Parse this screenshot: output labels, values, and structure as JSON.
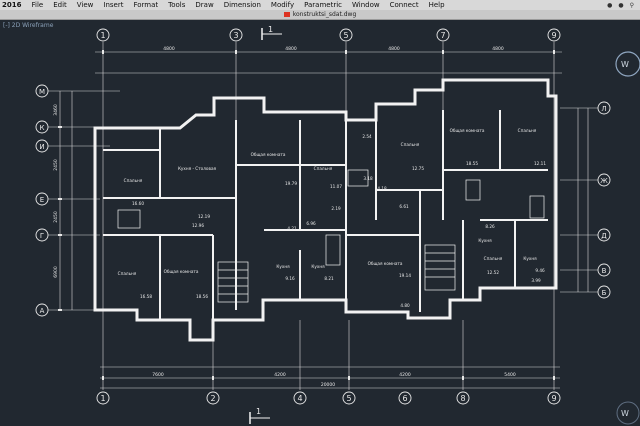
{
  "menubar": {
    "app": "2016",
    "items": [
      "File",
      "Edit",
      "View",
      "Insert",
      "Format",
      "Tools",
      "Draw",
      "Dimension",
      "Modify",
      "Parametric",
      "Window",
      "Connect",
      "Help"
    ]
  },
  "document": {
    "title": "konstruktsi_sdat.dwg"
  },
  "viewport": {
    "label": "[-] 2D Wireframe"
  },
  "viewcube": {
    "label": "W"
  },
  "section_mark": {
    "label": "1"
  },
  "grid": {
    "columns_top": [
      "1",
      "3",
      "5",
      "7",
      "9"
    ],
    "columns_bottom": [
      "1",
      "2",
      "4",
      "5",
      "6",
      "8",
      "9"
    ],
    "rows_left": [
      "М",
      "К",
      "И",
      "Е",
      "Г",
      "А"
    ],
    "rows_right": [
      "Л",
      "Ж",
      "Д",
      "В",
      "Б"
    ]
  },
  "dimensions": {
    "top": [
      "4800",
      "4800",
      "4800",
      "4800",
      "4800"
    ],
    "bottom_total": "20000",
    "bottom_segments": [
      "7600",
      "4200",
      "4200",
      "5400"
    ],
    "left": [
      "3460",
      "2450",
      "2450",
      "6900"
    ]
  },
  "rooms": [
    {
      "name": "Спальня",
      "area": "16.60"
    },
    {
      "name": "Кухня - Столовая",
      "area": "12.19"
    },
    {
      "name": "Общая комната",
      "area": "19.79"
    },
    {
      "name": "Спальня",
      "area": "11.07"
    },
    {
      "name": "Спальня",
      "area": "12.75"
    },
    {
      "name": "Общая комната",
      "area": "18.55"
    },
    {
      "name": "Спальня",
      "area": "12.11"
    },
    {
      "name": "Спальня",
      "area": "16.58"
    },
    {
      "name": "Общая комната",
      "area": "18.56"
    },
    {
      "name": "Кухня",
      "area": "9.16"
    },
    {
      "name": "Кухня",
      "area": "8.21"
    },
    {
      "name": "Общая комната",
      "area": "19.14"
    },
    {
      "name": "Кухня",
      "area": "8.26"
    },
    {
      "name": "Спальня",
      "area": "12.52"
    },
    {
      "name": "Кухня",
      "area": "9.46"
    }
  ],
  "small_areas": [
    "2.54",
    "3.18",
    "4.18",
    "2.19",
    "6.61",
    "6.96",
    "4.21",
    "4.80",
    "12.96",
    "3.99"
  ]
}
